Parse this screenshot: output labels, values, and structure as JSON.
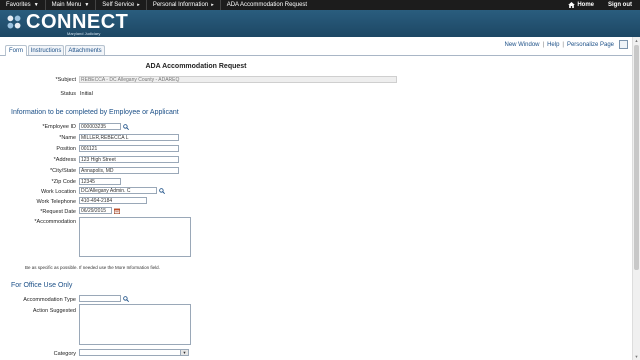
{
  "topnav": {
    "menus": [
      {
        "label": "Favorites"
      },
      {
        "label": "Main Menu"
      }
    ],
    "breadcrumbs": [
      "Self Service",
      "Personal Information",
      "ADA Accommodation Request"
    ],
    "home": "Home",
    "signout": "Sign out"
  },
  "brand": {
    "name": "CONNECT",
    "tagline": "Maryland Judiciary"
  },
  "tabs": [
    "Form",
    "Instructions",
    "Attachments"
  ],
  "links": {
    "new_window": "New Window",
    "help": "Help",
    "personalize": "Personalize Page"
  },
  "form": {
    "title": "ADA Accommodation Request",
    "subject_label": "*Subject",
    "subject_value": "REBECCA - DC Allegany County - ADAREQ",
    "status_label": "Status",
    "status_value": "Initial",
    "section_employee": "Information to be completed by Employee or Applicant",
    "employee_id_label": "*Employee ID",
    "employee_id_value": "000003235",
    "name_label": "*Name",
    "name_value": "MILLER,REBECCA L",
    "position_label": "Position",
    "position_value": "001121",
    "address_label": "*Address",
    "address_value": "123 High Street",
    "citystate_label": "*City/State",
    "citystate_value": "Annapolis, MD",
    "zip_label": "*Zip Code",
    "zip_value": "12345",
    "worklocation_label": "Work Location",
    "worklocation_value": "DC/Allegany Admin. C",
    "worktelephone_label": "Work Telephone",
    "worktelephone_value": "410-494-2184",
    "requestdate_label": "*Request Date",
    "requestdate_value": "06/29/2015",
    "accommodation_label": "*Accommodation",
    "accommodation_hint": "Be as specific as possible. If needed use the More Information field.",
    "section_office": "For Office Use Only",
    "accommodation_type_label": "Accommodation Type",
    "action_suggested_label": "Action Suggested",
    "category_label": "Category"
  },
  "colors": {
    "topnav": "#1c1c1c",
    "brand": "#2a5d7e",
    "link": "#1b4f87"
  }
}
